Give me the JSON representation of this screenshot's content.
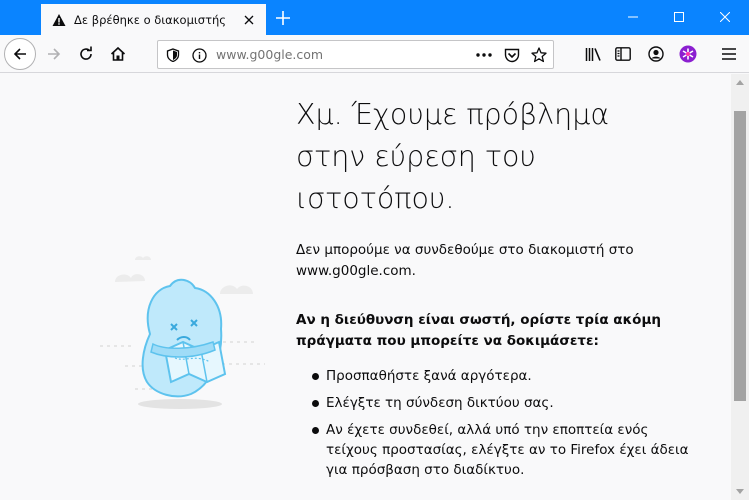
{
  "tab": {
    "title": "Δε βρέθηκε ο διακομιστής"
  },
  "url": {
    "address": "www.g00gle.com"
  },
  "error": {
    "heading": "Χμ. Έχουμε πρόβλημα στην εύρεση του ιστοτόπου.",
    "description": "Δεν μπορούμε να συνδεθούμε στο διακομιστή στο www.g00gle.com.",
    "suggestions_title": "Αν η διεύθυνση είναι σωστή, ορίστε τρία ακόμη πράγματα που μπορείτε να δοκιμάσετε:",
    "suggestions": [
      "Προσπαθήστε ξανά αργότερα.",
      "Ελέγξτε τη σύνδεση δικτύου σας.",
      "Αν έχετε συνδεθεί, αλλά υπό την εποπτεία ενός τείχους προστασίας, ελέγξτε αν το Firefox έχει άδεια για πρόσβαση στο διαδίκτυο."
    ]
  },
  "colors": {
    "titlebar": "#0a84ff",
    "page_bg": "#f9f9fa",
    "text": "#0c0c0d",
    "illustration": "#7dd3f5"
  },
  "icons": [
    "warning-icon",
    "close-icon",
    "plus-icon",
    "minimize-icon",
    "maximize-icon",
    "window-close-icon",
    "back-icon",
    "forward-icon",
    "reload-icon",
    "home-icon",
    "shield-icon",
    "info-icon",
    "more-icon",
    "pocket-icon",
    "star-icon",
    "library-icon",
    "sidebar-icon",
    "account-icon",
    "extension-icon",
    "menu-icon"
  ]
}
